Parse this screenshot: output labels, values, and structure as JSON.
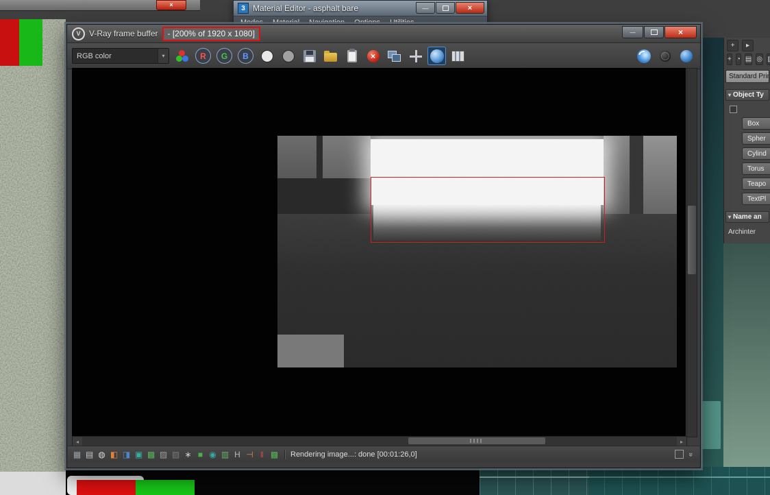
{
  "colors": {
    "annotation_red": "#e01010",
    "region_red": "#cc2020",
    "active_toolbar_blue": "#4f8fd8"
  },
  "material_editor": {
    "logo_text": "3",
    "title": "Material Editor - asphalt bare",
    "menu_items": [
      "Modes",
      "Material",
      "Navigation",
      "Options",
      "Utilities"
    ]
  },
  "command_panel": {
    "header_icons": [
      {
        "name": "pin-stack-icon",
        "glyph": "+"
      },
      {
        "name": "arrow-icon",
        "glyph": "▸"
      }
    ],
    "tab_icons": [
      {
        "name": "create-tab-icon",
        "glyph": "+"
      },
      {
        "name": "modify-tab-icon",
        "glyph": "◔"
      },
      {
        "name": "hierarchy-tab-icon",
        "glyph": "▤"
      },
      {
        "name": "motion-tab-icon",
        "glyph": "◎"
      },
      {
        "name": "display-tab-icon",
        "glyph": "▥"
      }
    ],
    "category": "Standard Prim",
    "object_type_rollout": "Object Ty",
    "buttons": [
      "Box",
      "Spher",
      "Cylind",
      "Torus",
      "Teapo",
      "TextPl"
    ],
    "name_rollout": "Name an",
    "object_name": "Archinter"
  },
  "vfb": {
    "title": "V-Ray frame buffer",
    "zoom_label": "- [200% of 1920 x 1080]",
    "channel_selector": "RGB color",
    "toolbar_icons_left": [
      {
        "name": "rgb-channels-icon",
        "kind": "rgbdots"
      },
      {
        "name": "red-channel-button",
        "kind": "chan",
        "letter": "R",
        "color": "#ff5050"
      },
      {
        "name": "green-channel-button",
        "kind": "chan",
        "letter": "G",
        "color": "#4cc44c"
      },
      {
        "name": "blue-channel-button",
        "kind": "chan",
        "letter": "B",
        "color": "#5a9cff"
      },
      {
        "name": "alpha-channel-button",
        "kind": "dot",
        "color": "#e8e8e8"
      },
      {
        "name": "monochrome-button",
        "kind": "dot",
        "color": "#a0a0a0"
      },
      {
        "name": "save-image-button",
        "kind": "floppy"
      },
      {
        "name": "open-image-button",
        "kind": "folder"
      },
      {
        "name": "clipboard-button",
        "kind": "clipboard"
      },
      {
        "name": "clear-image-button",
        "kind": "clear"
      },
      {
        "name": "duplicate-to-host-button",
        "kind": "dup"
      },
      {
        "name": "track-mouse-button",
        "kind": "track"
      },
      {
        "name": "region-render-button",
        "kind": "region",
        "active": true
      },
      {
        "name": "compare-columns-button",
        "kind": "cols"
      }
    ],
    "toolbar_icons_right": [
      {
        "name": "lens-effects-button",
        "kind": "lens"
      },
      {
        "name": "stereo-globe-button",
        "kind": "globe"
      },
      {
        "name": "render-last-button",
        "kind": "bluedot"
      }
    ],
    "statusbar_icons": [
      {
        "name": "grid-layout-icon",
        "glyph": "▦",
        "color": "#9aa0a6"
      },
      {
        "name": "layers-icon",
        "glyph": "▤",
        "color": "#c0c4c8"
      },
      {
        "name": "info-icon",
        "glyph": "◍",
        "color": "#d8d8d8"
      },
      {
        "name": "orange-split-icon",
        "glyph": "◧",
        "color": "#e0813a"
      },
      {
        "name": "blue-split-icon",
        "glyph": "◨",
        "color": "#4a86c8"
      },
      {
        "name": "teal-panel-icon",
        "glyph": "▣",
        "color": "#35b0a0"
      },
      {
        "name": "green-grid-icon",
        "glyph": "▩",
        "color": "#58b058"
      },
      {
        "name": "gray-hatch-icon",
        "glyph": "▨",
        "color": "#9a9a9a"
      },
      {
        "name": "dark-hatch-icon",
        "glyph": "▧",
        "color": "#787878"
      },
      {
        "name": "snowflake-icon",
        "glyph": "∗",
        "color": "#cccccc"
      },
      {
        "name": "green-square-icon",
        "glyph": "■",
        "color": "#4cae4c"
      },
      {
        "name": "lens-circle-icon",
        "glyph": "◉",
        "color": "#3aa8a0"
      },
      {
        "name": "film-icon",
        "glyph": "▥",
        "color": "#6ab06a"
      },
      {
        "name": "letter-h-icon",
        "glyph": "H",
        "color": "#b8b8b8"
      },
      {
        "name": "resize-icon",
        "glyph": "⊣",
        "color": "#e08a3a"
      },
      {
        "name": "pause-icon",
        "glyph": "‖",
        "color": "#d04848"
      },
      {
        "name": "checker-icon",
        "glyph": "▩",
        "color": "#58b058"
      }
    ],
    "status_text": "Rendering image...: done [00:01:26,0]"
  }
}
